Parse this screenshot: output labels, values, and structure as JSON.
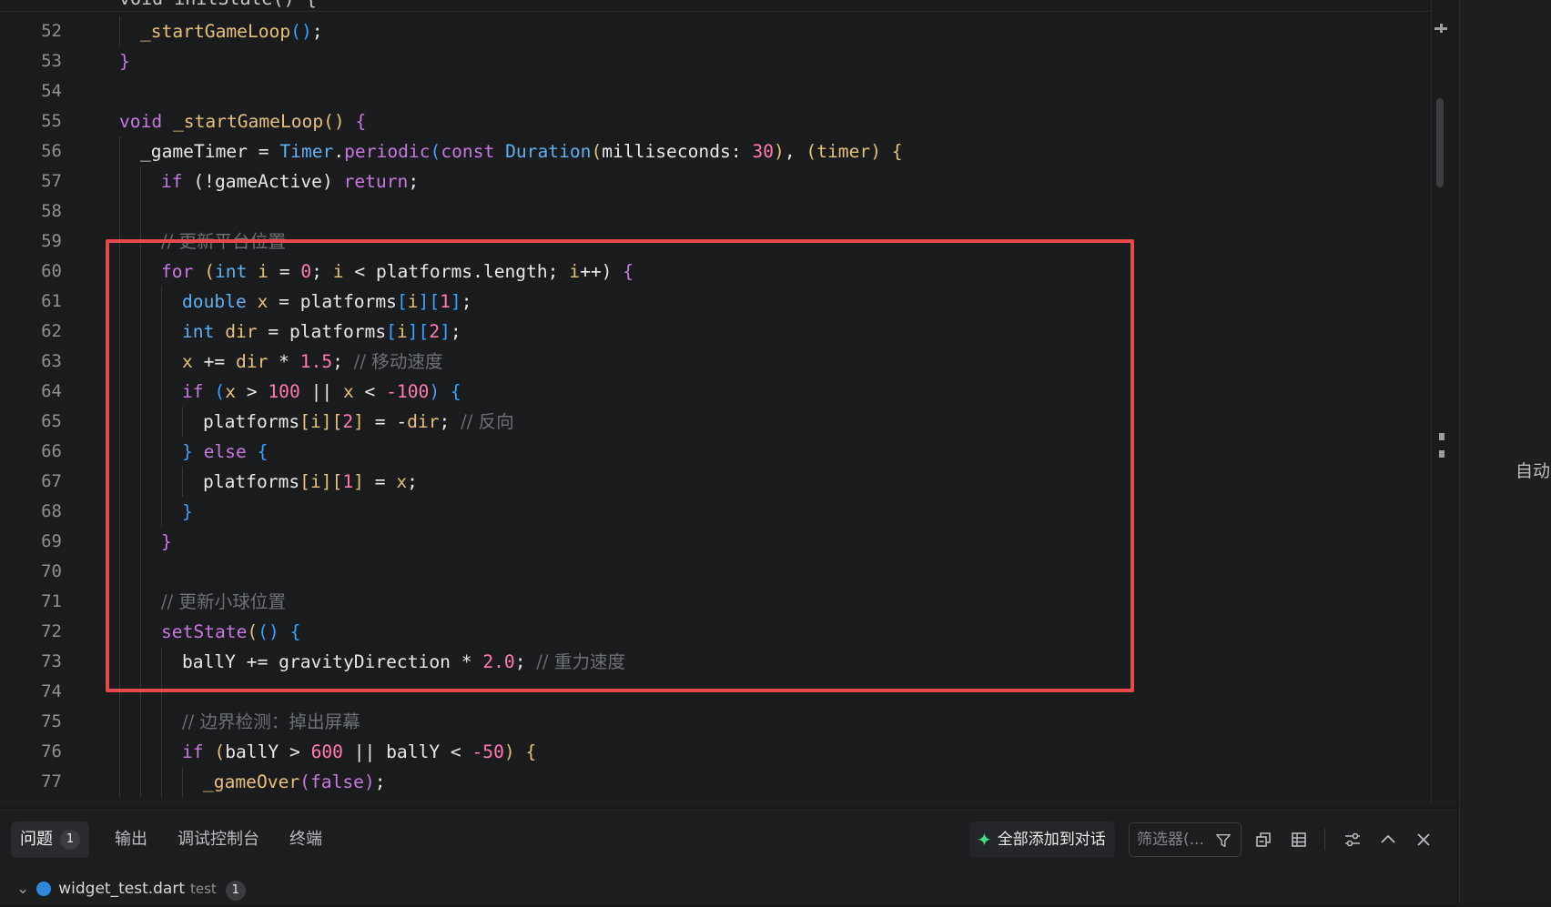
{
  "editor": {
    "partial_top_line": "void initState() {",
    "lines": [
      {
        "n": "52",
        "indent": 1,
        "tokens": [
          [
            "_startGameLoop",
            "fncall"
          ],
          [
            "()",
            "p3"
          ],
          [
            ";",
            "id"
          ]
        ]
      },
      {
        "n": "53",
        "indent": 0,
        "tokens": [
          [
            "}",
            "p2"
          ]
        ]
      },
      {
        "n": "54",
        "indent": 0,
        "tokens": []
      },
      {
        "n": "55",
        "indent": 0,
        "tokens": [
          [
            "void ",
            "kw"
          ],
          [
            "_startGameLoop",
            "fncall"
          ],
          [
            "() ",
            "p1"
          ],
          [
            "{",
            "p2"
          ]
        ]
      },
      {
        "n": "56",
        "indent": 1,
        "tokens": [
          [
            "_gameTimer ",
            "id"
          ],
          [
            "= ",
            "id"
          ],
          [
            "Timer",
            "type"
          ],
          [
            ".",
            "id"
          ],
          [
            "periodic",
            "kw"
          ],
          [
            "(",
            "p3"
          ],
          [
            "const ",
            "kw"
          ],
          [
            "Duration",
            "type"
          ],
          [
            "(",
            "p1"
          ],
          [
            "milliseconds",
            "id"
          ],
          [
            ": ",
            "id"
          ],
          [
            "30",
            "num"
          ],
          [
            ")",
            "p1"
          ],
          [
            ", ",
            "id"
          ],
          [
            "(",
            "p1"
          ],
          [
            "timer",
            "fncall"
          ],
          [
            ") ",
            "p1"
          ],
          [
            "{",
            "p1"
          ]
        ]
      },
      {
        "n": "57",
        "indent": 2,
        "tokens": [
          [
            "if ",
            "kw"
          ],
          [
            "(!gameActive) ",
            "id"
          ],
          [
            "return",
            "kw"
          ],
          [
            ";",
            "id"
          ]
        ]
      },
      {
        "n": "58",
        "indent": 2,
        "tokens": []
      },
      {
        "n": "59",
        "indent": 2,
        "tokens": [
          [
            "// 更新平台位置",
            "cm"
          ]
        ]
      },
      {
        "n": "60",
        "indent": 2,
        "tokens": [
          [
            "for ",
            "kw"
          ],
          [
            "(",
            "p1"
          ],
          [
            "int ",
            "type"
          ],
          [
            "i ",
            "var"
          ],
          [
            "= ",
            "id"
          ],
          [
            "0",
            "num"
          ],
          [
            "; ",
            "id"
          ],
          [
            "i ",
            "var"
          ],
          [
            "< ",
            "id"
          ],
          [
            "platforms",
            "id"
          ],
          [
            ".length; ",
            "id"
          ],
          [
            "i",
            "var"
          ],
          [
            "++) ",
            "id"
          ],
          [
            "{",
            "p2"
          ]
        ]
      },
      {
        "n": "61",
        "indent": 3,
        "tokens": [
          [
            "double ",
            "type"
          ],
          [
            "x ",
            "var"
          ],
          [
            "= ",
            "id"
          ],
          [
            "platforms",
            "id"
          ],
          [
            "[",
            "p3"
          ],
          [
            "i",
            "var"
          ],
          [
            "]",
            "p3"
          ],
          [
            "[",
            "p3"
          ],
          [
            "1",
            "num"
          ],
          [
            "]",
            "p3"
          ],
          [
            ";",
            "id"
          ]
        ]
      },
      {
        "n": "62",
        "indent": 3,
        "tokens": [
          [
            "int ",
            "type"
          ],
          [
            "dir ",
            "var"
          ],
          [
            "= ",
            "id"
          ],
          [
            "platforms",
            "id"
          ],
          [
            "[",
            "p3"
          ],
          [
            "i",
            "var"
          ],
          [
            "]",
            "p3"
          ],
          [
            "[",
            "p3"
          ],
          [
            "2",
            "num"
          ],
          [
            "]",
            "p3"
          ],
          [
            ";",
            "id"
          ]
        ]
      },
      {
        "n": "63",
        "indent": 3,
        "tokens": [
          [
            "x ",
            "var"
          ],
          [
            "+= ",
            "id"
          ],
          [
            "dir ",
            "var"
          ],
          [
            "* ",
            "id"
          ],
          [
            "1.5",
            "num"
          ],
          [
            "; ",
            "id"
          ],
          [
            "// 移动速度",
            "cm"
          ]
        ]
      },
      {
        "n": "64",
        "indent": 3,
        "tokens": [
          [
            "if ",
            "kw"
          ],
          [
            "(",
            "p3"
          ],
          [
            "x ",
            "var"
          ],
          [
            "> ",
            "id"
          ],
          [
            "100 ",
            "num"
          ],
          [
            "|| ",
            "id"
          ],
          [
            "x ",
            "var"
          ],
          [
            "< ",
            "id"
          ],
          [
            "-100",
            "num"
          ],
          [
            ") ",
            "p3"
          ],
          [
            "{",
            "p3"
          ]
        ]
      },
      {
        "n": "65",
        "indent": 4,
        "tokens": [
          [
            "platforms",
            "id"
          ],
          [
            "[",
            "p1"
          ],
          [
            "i",
            "var"
          ],
          [
            "]",
            "p1"
          ],
          [
            "[",
            "p1"
          ],
          [
            "2",
            "num"
          ],
          [
            "]",
            "p1"
          ],
          [
            " = -",
            "id"
          ],
          [
            "dir",
            "var"
          ],
          [
            "; ",
            "id"
          ],
          [
            "// 反向",
            "cm"
          ]
        ]
      },
      {
        "n": "66",
        "indent": 3,
        "tokens": [
          [
            "} ",
            "p3"
          ],
          [
            "else ",
            "kw"
          ],
          [
            "{",
            "p3"
          ]
        ]
      },
      {
        "n": "67",
        "indent": 4,
        "tokens": [
          [
            "platforms",
            "id"
          ],
          [
            "[",
            "p1"
          ],
          [
            "i",
            "var"
          ],
          [
            "]",
            "p1"
          ],
          [
            "[",
            "p1"
          ],
          [
            "1",
            "num"
          ],
          [
            "]",
            "p1"
          ],
          [
            " = ",
            "id"
          ],
          [
            "x",
            "var"
          ],
          [
            ";",
            "id"
          ]
        ]
      },
      {
        "n": "68",
        "indent": 3,
        "tokens": [
          [
            "}",
            "p3"
          ]
        ]
      },
      {
        "n": "69",
        "indent": 2,
        "tokens": [
          [
            "}",
            "p2"
          ]
        ]
      },
      {
        "n": "70",
        "indent": 2,
        "tokens": []
      },
      {
        "n": "71",
        "indent": 2,
        "tokens": [
          [
            "// 更新小球位置",
            "cm"
          ]
        ]
      },
      {
        "n": "72",
        "indent": 2,
        "tokens": [
          [
            "setState",
            "kw"
          ],
          [
            "(",
            "p1"
          ],
          [
            "() ",
            "p3"
          ],
          [
            "{",
            "p3"
          ]
        ]
      },
      {
        "n": "73",
        "indent": 3,
        "tokens": [
          [
            "ballY ",
            "id"
          ],
          [
            "+= ",
            "id"
          ],
          [
            "gravityDirection ",
            "id"
          ],
          [
            "* ",
            "id"
          ],
          [
            "2.0",
            "num"
          ],
          [
            "; ",
            "id"
          ],
          [
            "// 重力速度",
            "cm"
          ]
        ]
      },
      {
        "n": "74",
        "indent": 3,
        "tokens": []
      },
      {
        "n": "75",
        "indent": 3,
        "tokens": [
          [
            "// 边界检测：掉出屏幕",
            "cm"
          ]
        ]
      },
      {
        "n": "76",
        "indent": 3,
        "tokens": [
          [
            "if ",
            "kw"
          ],
          [
            "(",
            "p1"
          ],
          [
            "ballY ",
            "id"
          ],
          [
            "> ",
            "id"
          ],
          [
            "600 ",
            "num"
          ],
          [
            "|| ",
            "id"
          ],
          [
            "ballY ",
            "id"
          ],
          [
            "< ",
            "id"
          ],
          [
            "-50",
            "num"
          ],
          [
            ") ",
            "p1"
          ],
          [
            "{",
            "p1"
          ]
        ]
      },
      {
        "n": "77",
        "indent": 4,
        "tokens": [
          [
            "_gameOver",
            "fncall"
          ],
          [
            "(",
            "p2"
          ],
          [
            "false",
            "kw"
          ],
          [
            ")",
            "p2"
          ],
          [
            ";",
            "id"
          ]
        ]
      }
    ]
  },
  "right_pane": {
    "label": "自动"
  },
  "panel": {
    "tabs": [
      {
        "label": "问题",
        "badge": "1",
        "active": true
      },
      {
        "label": "输出"
      },
      {
        "label": "调试控制台"
      },
      {
        "label": "终端"
      }
    ],
    "add_all_label": "全部添加到对话",
    "filter_placeholder": "筛选器(...",
    "tree": {
      "file": "widget_test.dart",
      "folder": "test",
      "count": "1"
    }
  },
  "icons": {
    "add_all": "sparkle-icon",
    "filter": "filter-icon",
    "collapse_all": "collapse-all-icon",
    "table": "table-view-icon",
    "settings": "settings-sliders-icon",
    "maximize": "chevron-up-icon",
    "close": "close-icon"
  },
  "colors": {
    "highlight_box": "#e5484d",
    "editor_bg": "#1b1c1e",
    "keyword": "#c678dd",
    "type": "#61afef",
    "number": "#ff7ab2",
    "comment": "#6b6f76"
  }
}
